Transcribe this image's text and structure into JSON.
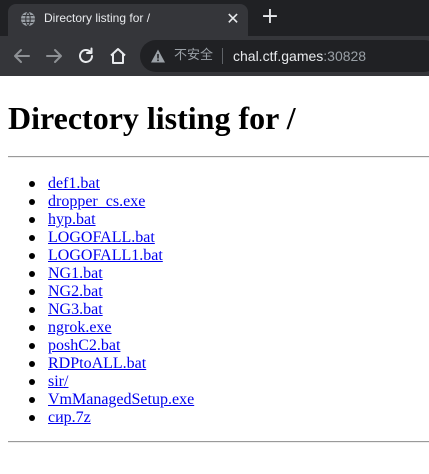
{
  "browser": {
    "tab_title": "Directory listing for /",
    "close_glyph": "✕",
    "new_tab_glyph": "+",
    "omnibox": {
      "security_label": "不安全",
      "host": "chal.ctf.games",
      "port": ":30828"
    }
  },
  "page": {
    "heading": "Directory listing for /",
    "files": [
      "def1.bat",
      "dropper_cs.exe",
      "hyp.bat",
      "LOGOFALL.bat",
      "LOGOFALL1.bat",
      "NG1.bat",
      "NG2.bat",
      "NG3.bat",
      "ngrok.exe",
      "poshC2.bat",
      "RDPtoALL.bat",
      "sir/",
      "VmManagedSetup.exe",
      "сир.7z"
    ]
  },
  "colors": {
    "tab_strip": "#202124",
    "toolbar": "#35363a",
    "link": "#0000ee"
  }
}
